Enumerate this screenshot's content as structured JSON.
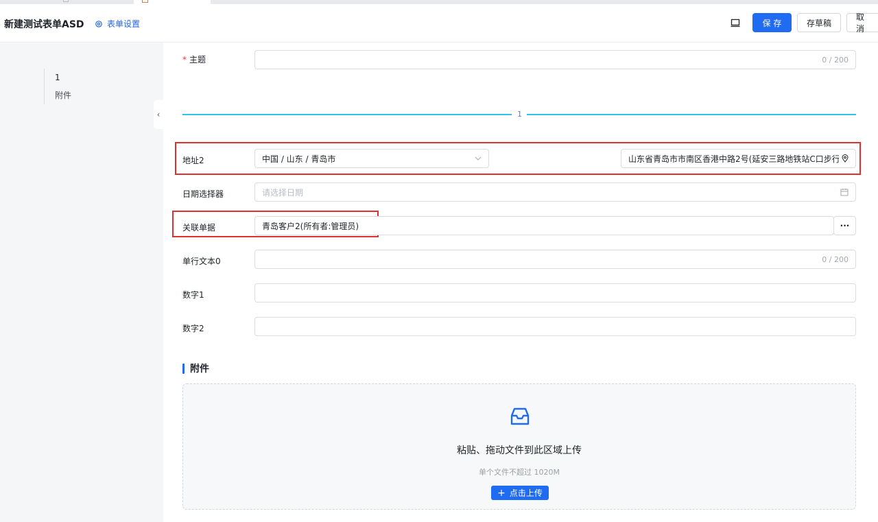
{
  "header": {
    "title": "新建测试表单ASD",
    "settings_label": "表单设置",
    "save_label": "保 存",
    "draft_label": "存草稿",
    "cancel_label": "取 消"
  },
  "sidebar": {
    "items": [
      {
        "label": "1"
      },
      {
        "label": "附件"
      }
    ],
    "collapse_icon": "‹"
  },
  "form": {
    "subject": {
      "label": "主题",
      "required": "*",
      "counter": "0 / 200",
      "value": ""
    },
    "divider_label": "1",
    "address": {
      "label": "地址2",
      "region": "中国 / 山东 / 青岛市",
      "detail": "山东省青岛市市南区香港中路2号(延安三路地铁站C口步行"
    },
    "date": {
      "label": "日期选择器",
      "placeholder": "请选择日期"
    },
    "related": {
      "label": "关联单据",
      "value": "青岛客户2(所有者:管理员)",
      "more": "···"
    },
    "text0": {
      "label": "单行文本0",
      "counter": "0 / 200"
    },
    "num1": {
      "label": "数字1"
    },
    "num2": {
      "label": "数字2"
    }
  },
  "attachment": {
    "section_title": "附件",
    "drop_text": "粘贴、拖动文件到此区域上传",
    "hint": "单个文件不超过 1020M",
    "upload_button": "点击上传",
    "upload_plus": "+"
  },
  "colors": {
    "primary": "#1f6bf2",
    "highlight": "#e0302e",
    "divider": "#36c2e6"
  },
  "icons": [
    "gear-icon",
    "monitor-icon",
    "chevron-left-icon",
    "chevron-down-icon",
    "calendar-icon",
    "location-pin-icon",
    "inbox-icon",
    "plus-icon"
  ]
}
